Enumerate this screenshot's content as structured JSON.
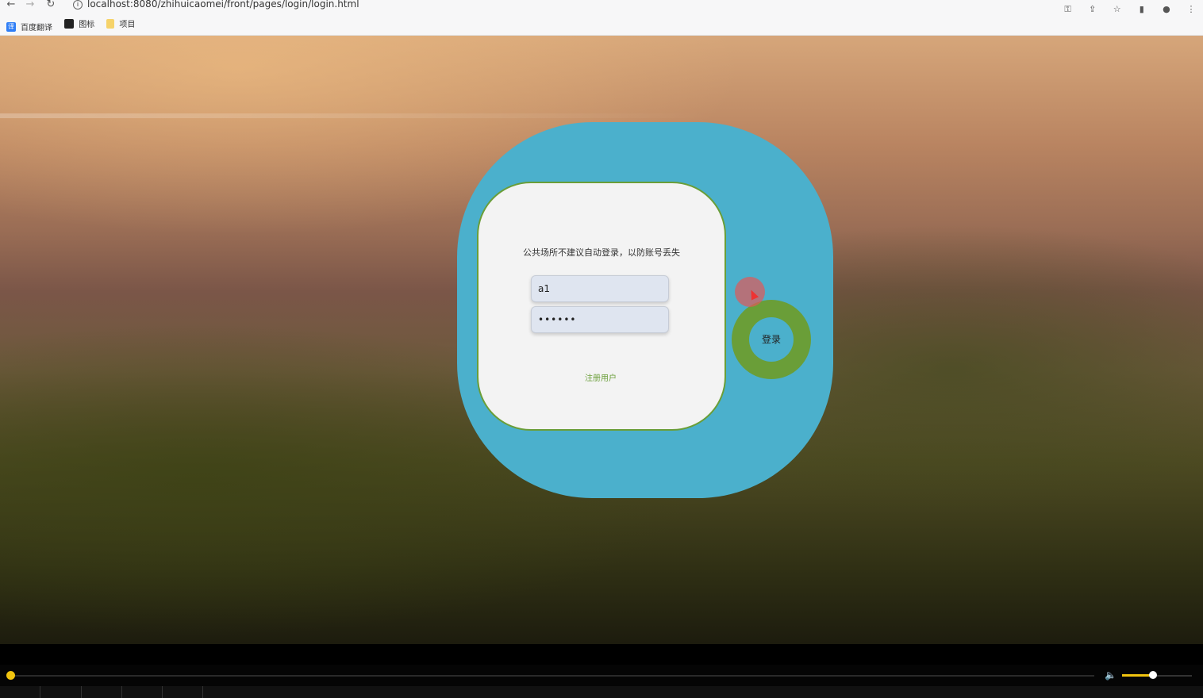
{
  "browser": {
    "url": "localhost:8080/zhihuicaomei/front/pages/login/login.html",
    "back_icon": "arrow-left-icon",
    "forward_icon": "arrow-right-icon",
    "reload_icon": "reload-icon",
    "bookmarks": [
      {
        "label": "百度翻译",
        "icon": "baidu-fanyi-icon"
      },
      {
        "label": "图标",
        "icon": "tubiao-icon"
      },
      {
        "label": "项目",
        "icon": "folder-icon"
      }
    ]
  },
  "login": {
    "notice": "公共场所不建议自动登录，以防账号丢失",
    "username_value": "a1",
    "password_value": "••••••",
    "register_label": "注册用户",
    "login_label": "登录"
  },
  "colors": {
    "outer_panel": "#4bb0cc",
    "card": "#f3f3f3",
    "accent_green": "#6a9e38",
    "field_bg": "#dfe5f0"
  },
  "player": {
    "seek_fraction": 0.0,
    "volume_fraction": 0.45
  }
}
